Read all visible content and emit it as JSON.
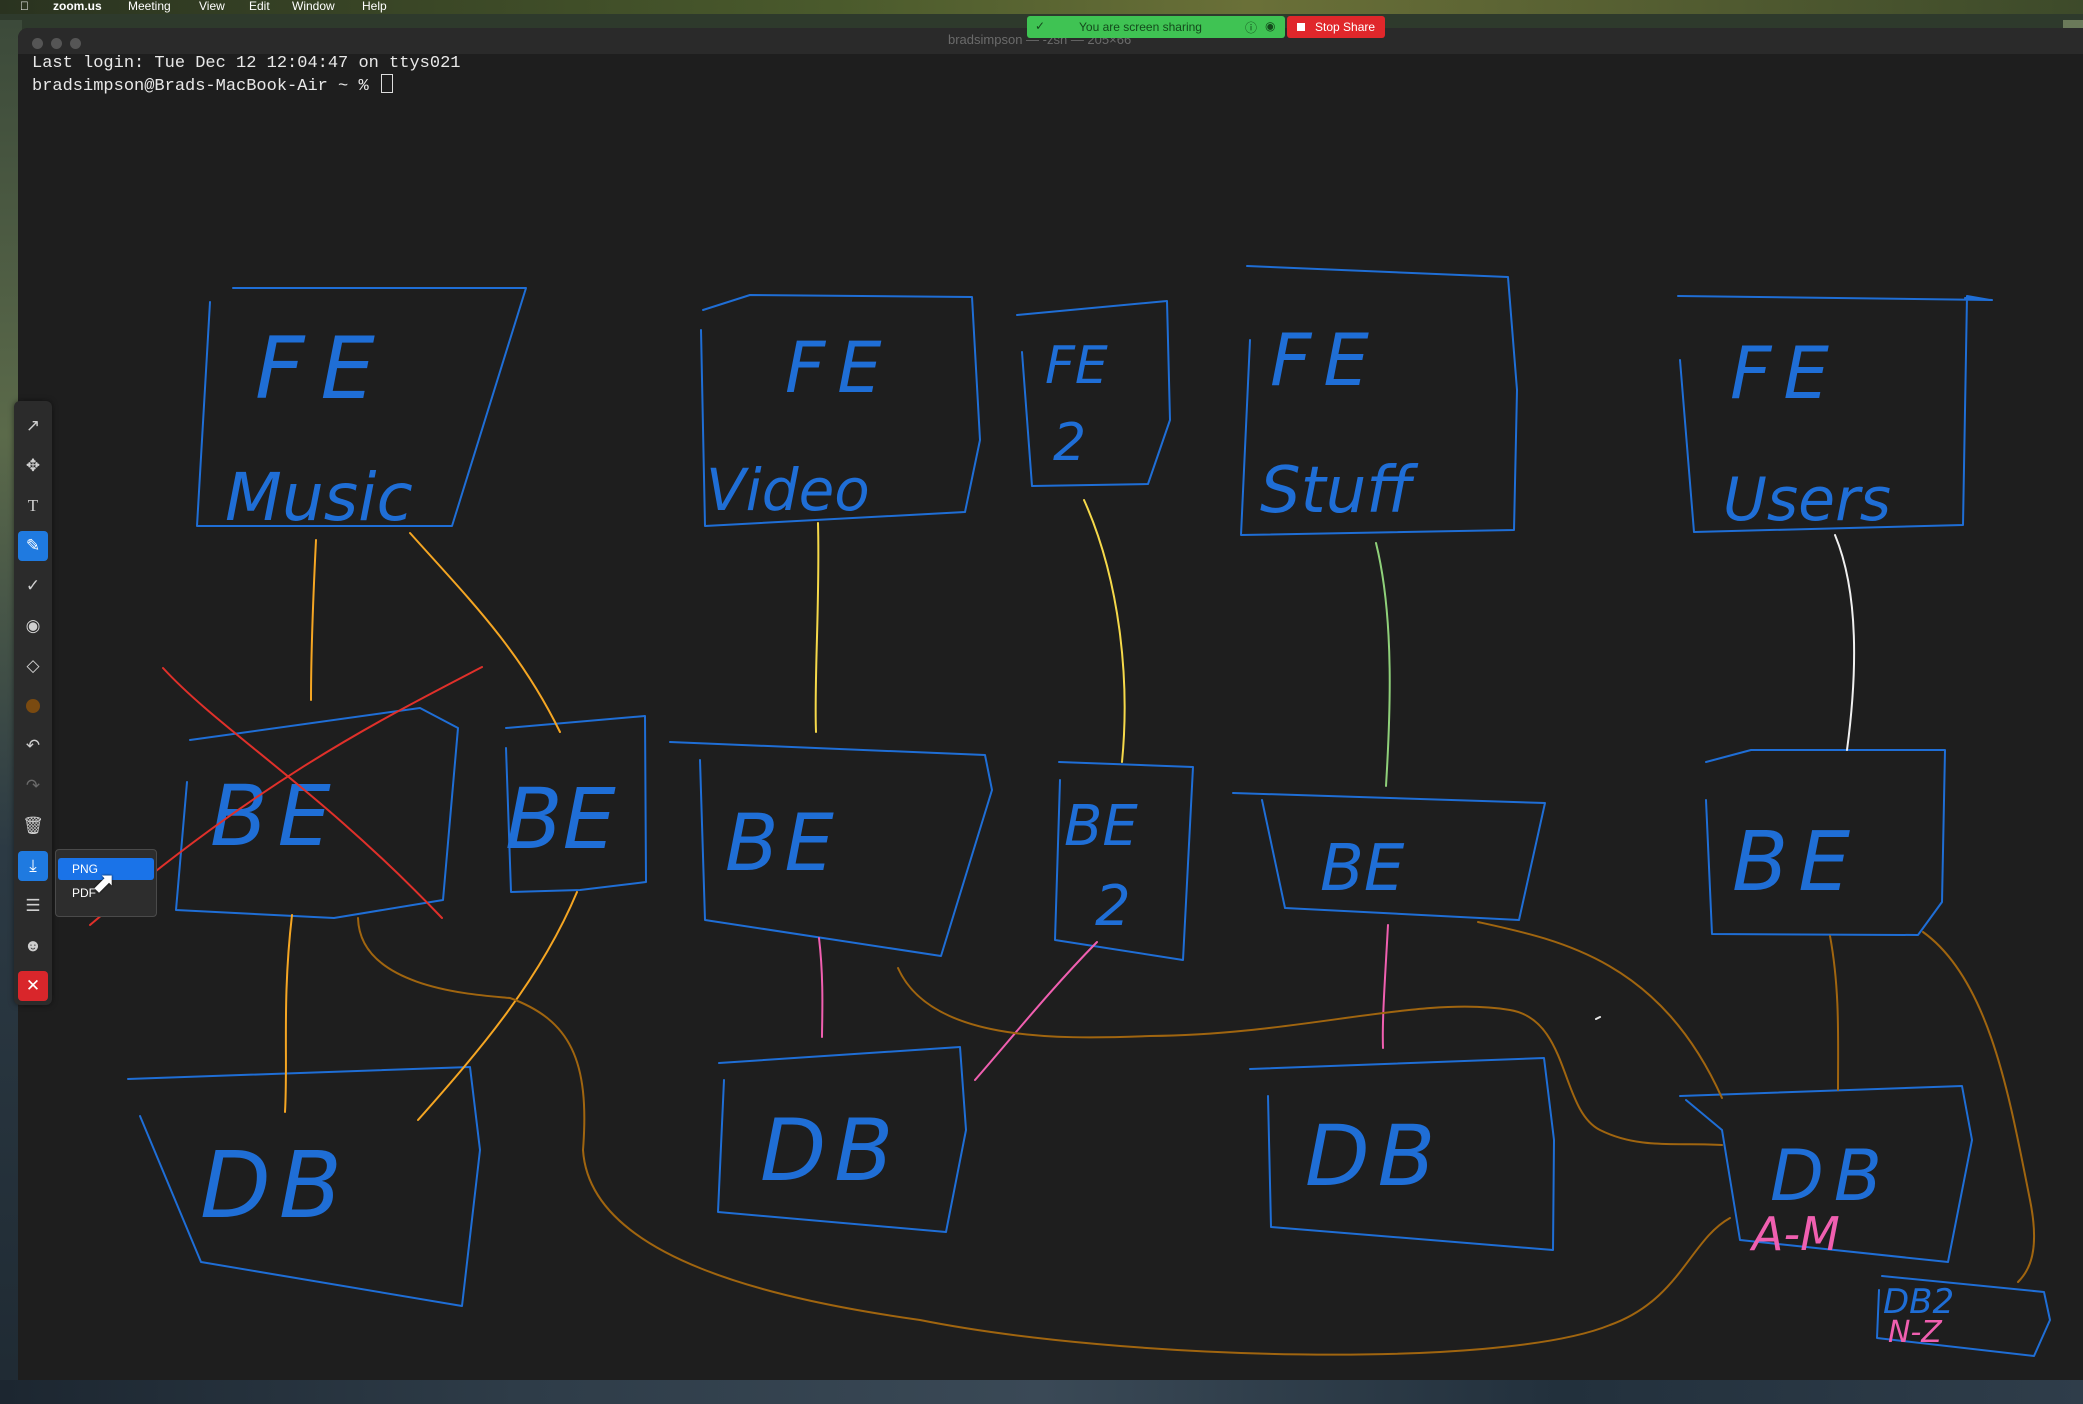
{
  "menubar": {
    "apple": "",
    "app": "zoom.us",
    "items": [
      "Meeting",
      "View",
      "Edit",
      "Window",
      "Help"
    ]
  },
  "terminal": {
    "window_title": "bradsimpson — -zsh — 205×66",
    "lines": [
      "Last login: Tue Dec 12 12:04:47 on ttys021",
      "bradsimpson@Brads-MacBook-Air ~ % "
    ]
  },
  "share": {
    "status_text": "You are screen sharing",
    "stop_label": "Stop Share"
  },
  "whiteboard": {
    "labels": {
      "fe": "FE",
      "be": "BE",
      "db": "DB",
      "music": "Music",
      "video": "Video",
      "two": "2",
      "stuff": "Stuff",
      "users": "Users",
      "a_m": "A-M",
      "db2": "DB2",
      "n_z": "N-Z"
    },
    "colors": {
      "boxes": "#1f6ed6",
      "link_orange": "#f5a623",
      "link_yellow": "#f5d94a",
      "link_green": "#8fd17a",
      "link_white": "#f0f0f0",
      "link_pink": "#f05fb0",
      "link_brown": "#a0650f",
      "cross_red": "#e0302a"
    }
  },
  "toolbar": {
    "tools": [
      "select-icon",
      "move-icon",
      "text-icon",
      "pen-icon",
      "stamp-icon",
      "spotlight-icon",
      "eraser-icon",
      "color-icon",
      "undo-icon",
      "redo-icon",
      "clear-icon",
      "save-icon",
      "menu-icon",
      "user-icon",
      "close-icon"
    ],
    "current_color": "#7a4a10",
    "save_options": [
      "PNG",
      "PDF"
    ],
    "selected_option": "PNG"
  }
}
